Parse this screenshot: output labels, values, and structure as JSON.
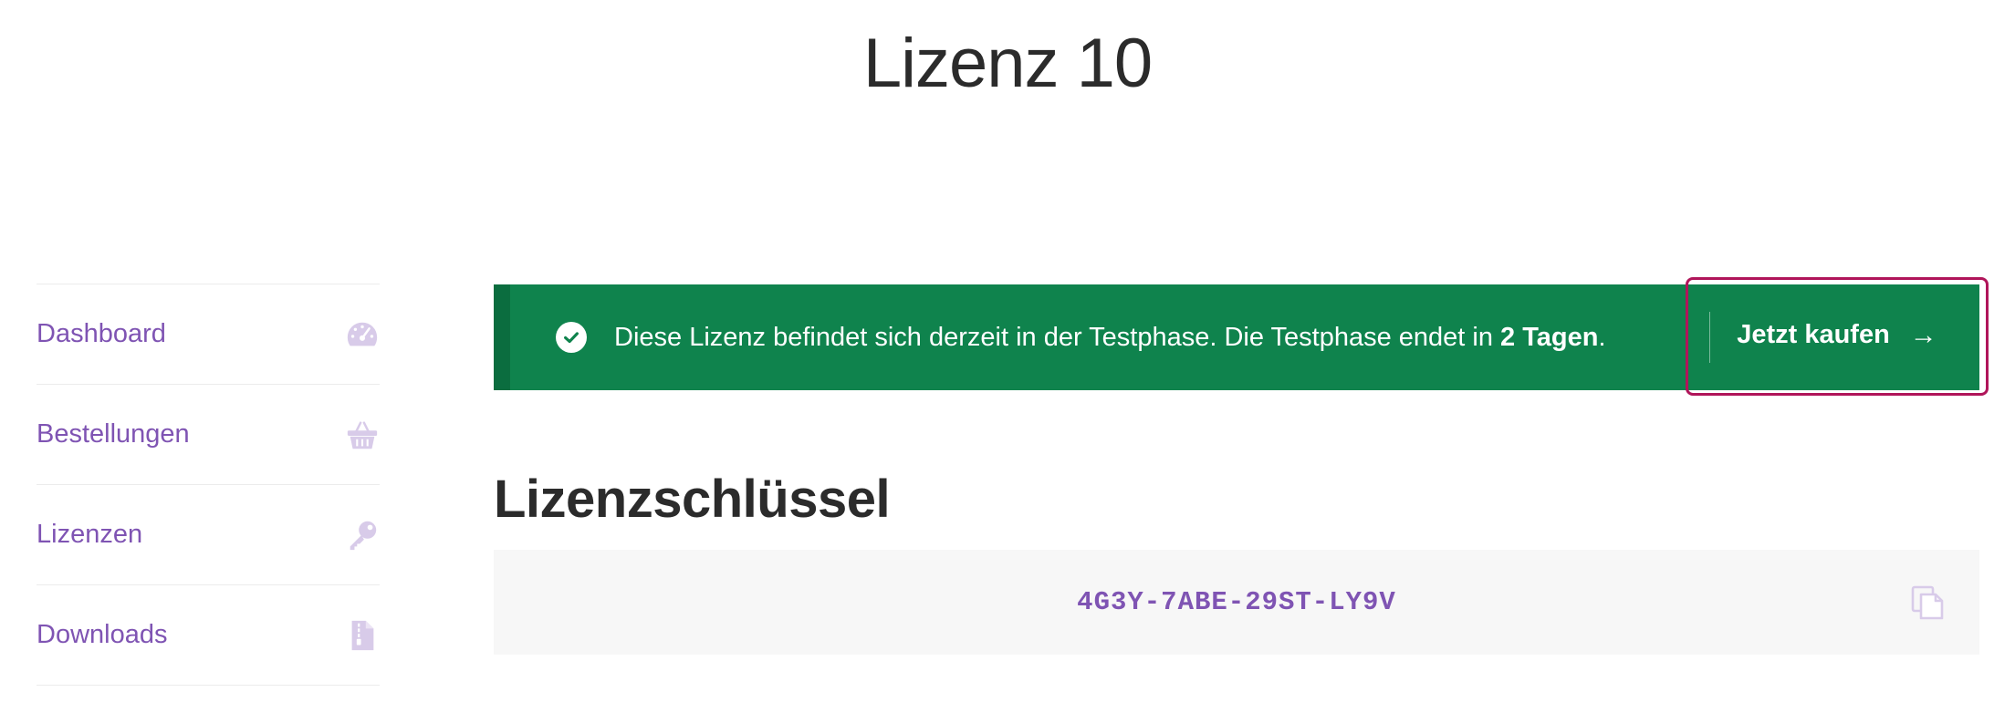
{
  "page": {
    "title": "Lizenz 10"
  },
  "sidebar": {
    "items": [
      {
        "label": "Dashboard",
        "icon": "dashboard-gauge-icon"
      },
      {
        "label": "Bestellungen",
        "icon": "basket-icon"
      },
      {
        "label": "Lizenzen",
        "icon": "key-icon"
      },
      {
        "label": "Downloads",
        "icon": "file-download-icon"
      }
    ]
  },
  "notice": {
    "text": "Diese Lizenz befindet sich derzeit in der Testphase. Die Testphase endet in ",
    "days_bold": "2 Tagen",
    "suffix": ".",
    "button_label": "Jetzt kaufen",
    "button_arrow": "→",
    "icon": "check-circle-icon"
  },
  "license_key": {
    "heading": "Lizenzschlüssel",
    "value": "4G3Y-7ABE-29ST-LY9V",
    "copy_icon": "copy-icon"
  },
  "colors": {
    "accent": "#7f54b3",
    "notice_bg": "#0f834d",
    "highlight_border": "#b0155a",
    "key_bg": "#f7f7f7"
  }
}
